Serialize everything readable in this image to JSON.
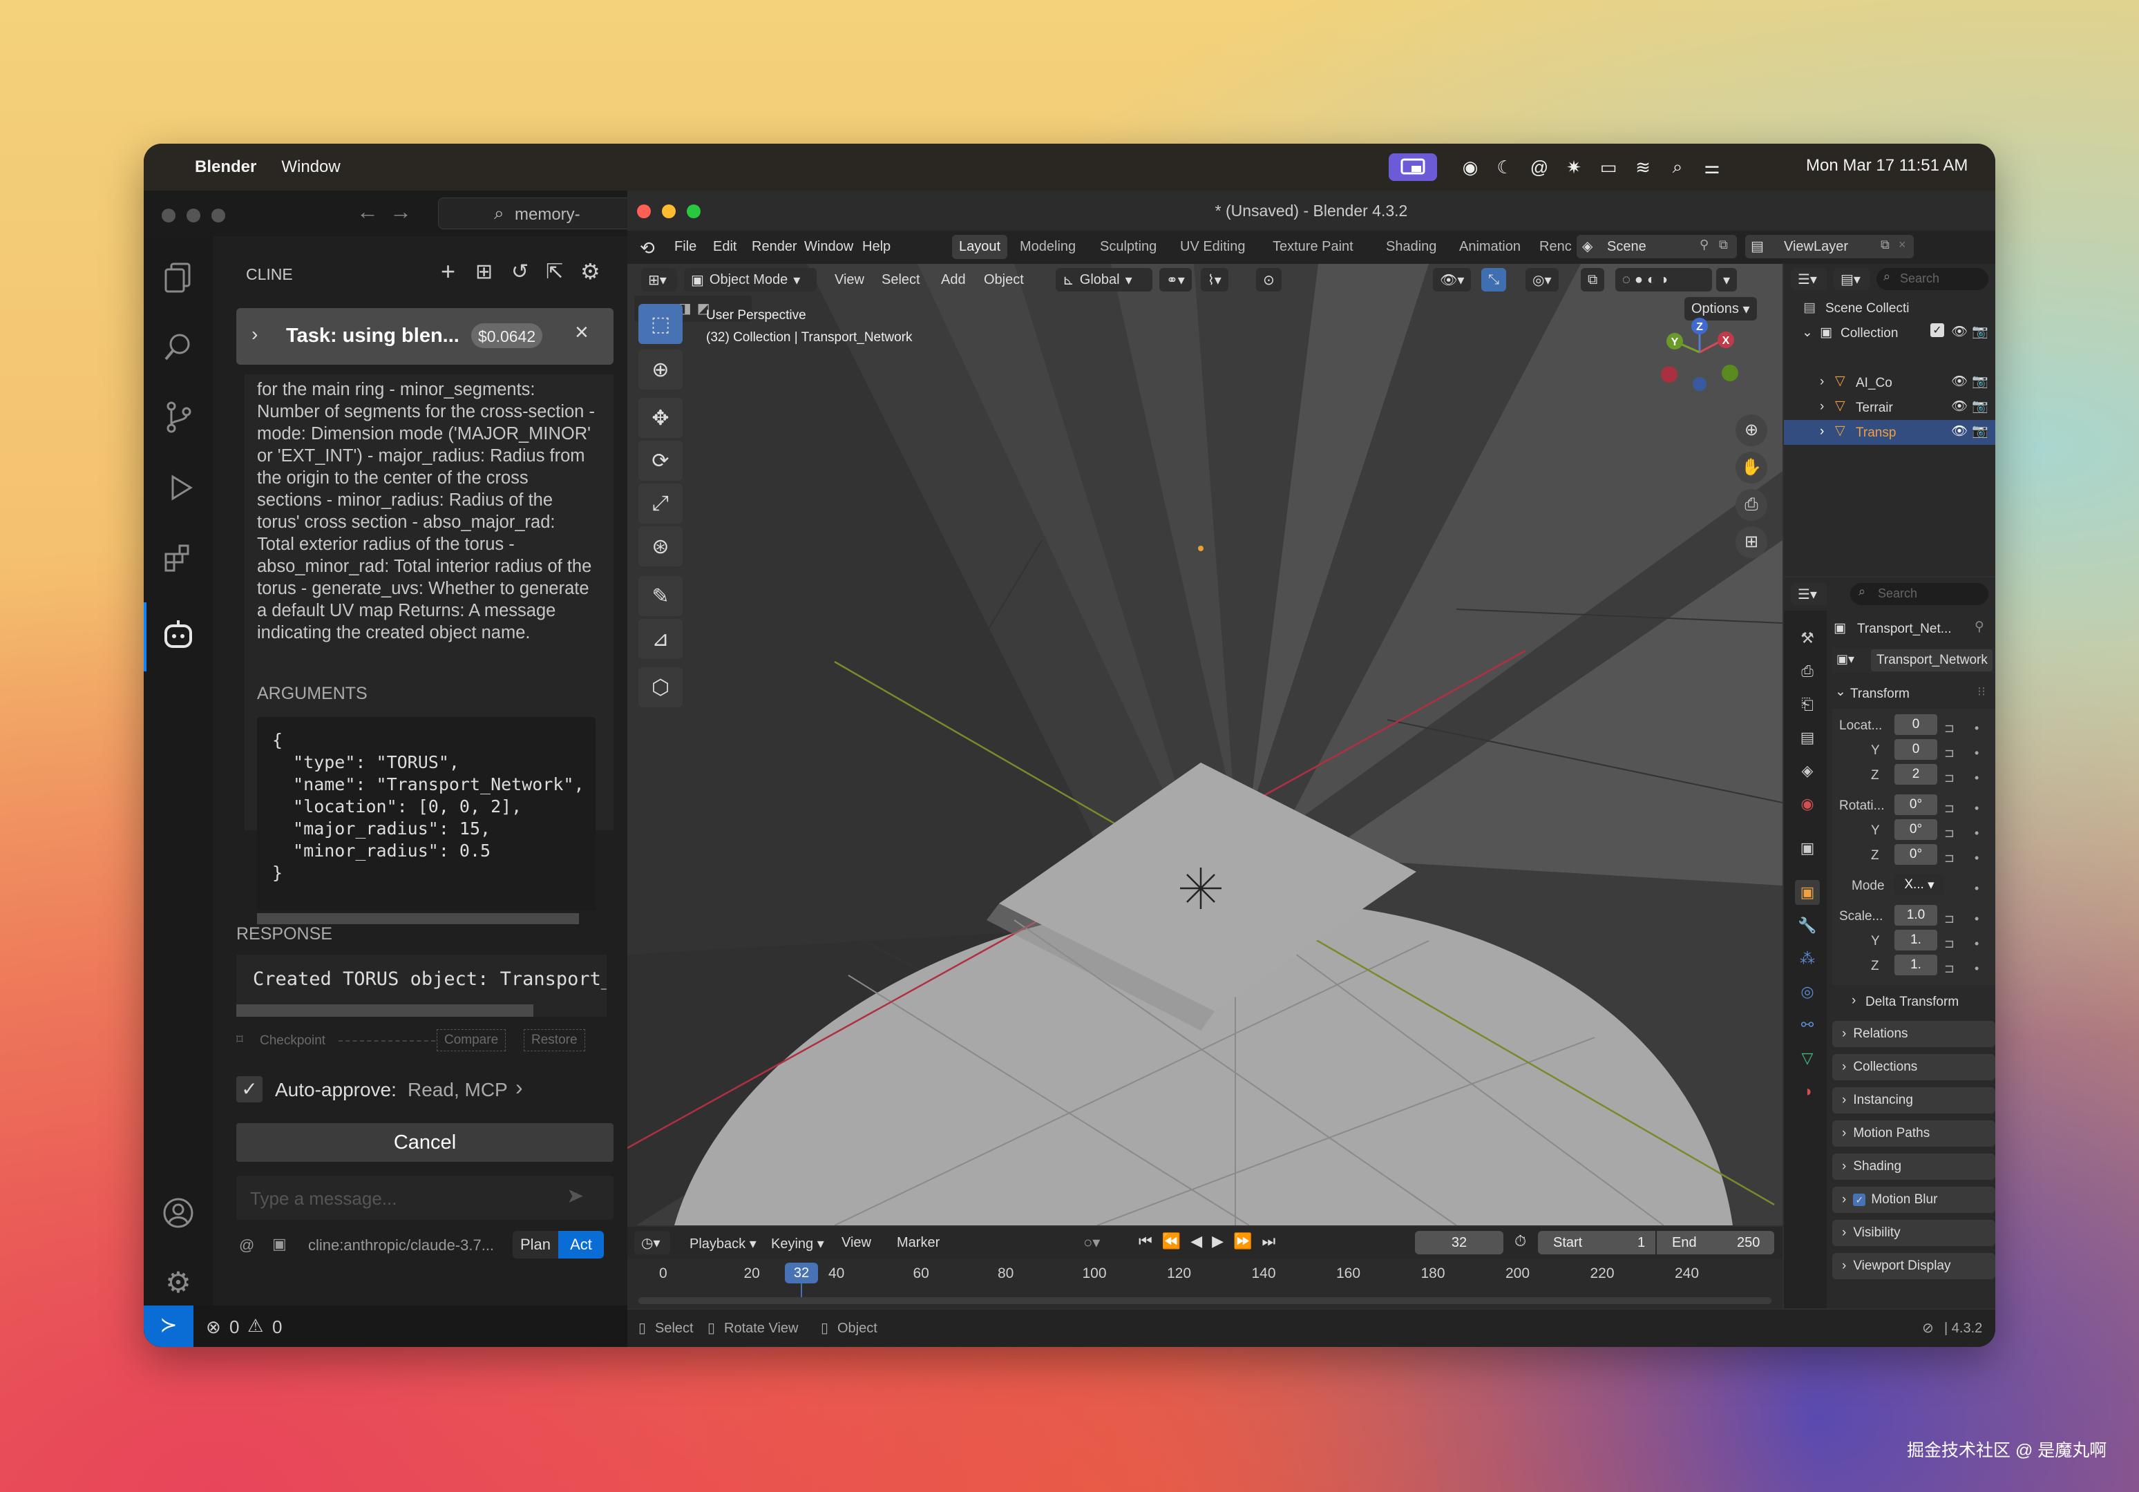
{
  "menubar": {
    "app_name": "Blender",
    "window_menu": "Window",
    "datetime": "Mon Mar 17  11:51 AM"
  },
  "vscode": {
    "title_search": "memory-",
    "cline": {
      "title": "CLINE",
      "task_title": "Task: using blen...",
      "task_cost": "$0.0642",
      "description": "for the main ring - minor_segments: Number of segments for the cross-section - mode: Dimension mode ('MAJOR_MINOR' or 'EXT_INT') - major_radius: Radius from the origin to the center of the cross sections - minor_radius: Radius of the torus' cross section - abso_major_rad: Total exterior radius of the torus - abso_minor_rad: Total interior radius of the torus - generate_uvs: Whether to generate a default UV map Returns: A message indicating the created object name.",
      "arguments_label": "ARGUMENTS",
      "arguments_code": [
        "{",
        "  \"type\": \"TORUS\",",
        "  \"name\": \"Transport_Network\",",
        "  \"location\": [0, 0, 2],",
        "  \"major_radius\": 15,",
        "  \"minor_radius\": 0.5",
        "}"
      ],
      "response_label": "RESPONSE",
      "response_text": "Created TORUS object: Transport_N",
      "checkpoint": "Checkpoint",
      "compare": "Compare",
      "restore": "Restore",
      "auto_approve_label": "Auto-approve:",
      "auto_approve_value": "Read, MCP",
      "cancel": "Cancel",
      "message_placeholder": "Type a message...",
      "model": "cline:anthropic/claude-3.7...",
      "plan": "Plan",
      "act": "Act"
    },
    "status": {
      "errors": "0",
      "warnings": "0"
    }
  },
  "blender": {
    "window_title": "* (Unsaved) - Blender 4.3.2",
    "menus": [
      "File",
      "Edit",
      "Render",
      "Window",
      "Help"
    ],
    "workspaces": [
      "Layout",
      "Modeling",
      "Sculpting",
      "UV Editing",
      "Texture Paint",
      "Shading",
      "Animation",
      "Renc"
    ],
    "scene": "Scene",
    "view_layer": "ViewLayer",
    "header": {
      "mode": "Object Mode",
      "menus": [
        "View",
        "Select",
        "Add",
        "Object"
      ],
      "transform": "Global",
      "options": "Options"
    },
    "viewport": {
      "perspective": "User Perspective",
      "collection_info": "(32) Collection | Transport_Network",
      "gizmo": {
        "x": "X",
        "y": "Y",
        "z": "Z"
      }
    },
    "outliner": {
      "search": "Search",
      "scene_collection": "Scene Collecti",
      "collection": "Collection",
      "items": [
        "AI_Co",
        "Terrair",
        "Transp"
      ]
    },
    "properties": {
      "search": "Search",
      "object_name": "Transport_Net...",
      "data_name": "Transport_Network",
      "transform": "Transform",
      "location_label": "Locat...",
      "location": [
        "0",
        "0",
        "2"
      ],
      "rotation_label": "Rotati...",
      "rotation": [
        "0°",
        "0°",
        "0°"
      ],
      "mode_label": "Mode",
      "mode_value": "X...",
      "scale_label": "Scale...",
      "scale": [
        "1.0",
        "1.",
        "1."
      ],
      "axes": [
        "Y",
        "Z"
      ],
      "delta": "Delta Transform",
      "panels": [
        "Relations",
        "Collections",
        "Instancing",
        "Motion Paths",
        "Shading",
        "Motion Blur",
        "Visibility",
        "Viewport Display"
      ]
    },
    "timeline": {
      "menus": [
        "Playback",
        "Keying",
        "View",
        "Marker"
      ],
      "current_frame": "32",
      "start_label": "Start",
      "start": "1",
      "end_label": "End",
      "end": "250",
      "ticks": [
        "0",
        "20",
        "40",
        "60",
        "80",
        "100",
        "120",
        "140",
        "160",
        "180",
        "200",
        "220",
        "240"
      ]
    },
    "statusbar": {
      "select": "Select",
      "rotate": "Rotate View",
      "object": "Object",
      "version": "4.3.2"
    }
  },
  "watermark": "掘金技术社区 @ 是魔丸啊"
}
